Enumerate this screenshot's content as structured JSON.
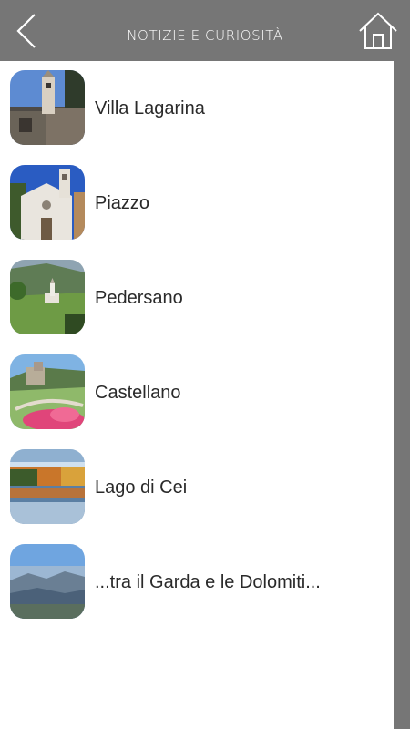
{
  "header": {
    "title": "NOTIZIE E CURIOSITÀ",
    "back_icon": "chevron-left-icon",
    "home_icon": "home-icon"
  },
  "colors": {
    "header_bg": "#767676",
    "content_bg": "#ffffff",
    "text": "#2a2a2a"
  },
  "items": [
    {
      "label": "Villa Lagarina",
      "thumb": "church-tower-photo"
    },
    {
      "label": "Piazzo",
      "thumb": "white-church-photo"
    },
    {
      "label": "Pedersano",
      "thumb": "valley-village-photo"
    },
    {
      "label": "Castellano",
      "thumb": "castle-garden-photo"
    },
    {
      "label": "Lago di Cei",
      "thumb": "lake-autumn-photo"
    },
    {
      "label": "...tra il Garda e le Dolomiti...",
      "thumb": "mountain-panorama-photo"
    }
  ]
}
